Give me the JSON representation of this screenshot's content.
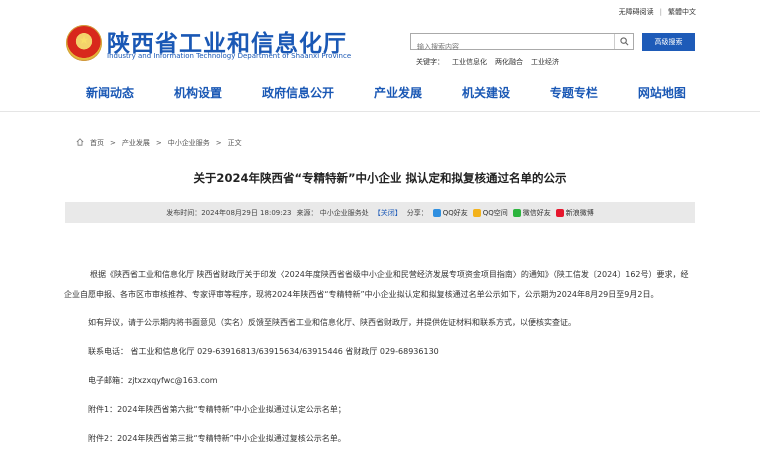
{
  "top_links": {
    "accessibility": "无障碍阅读",
    "language": "繁體中文"
  },
  "header": {
    "title": "陕西省工业和信息化厅",
    "subtitle": "Industry and Information Technology Department of Shaanxi Province"
  },
  "search": {
    "placeholder": "输入搜索内容",
    "advanced_label": "高级搜索"
  },
  "keywords": {
    "label": "关键字：",
    "items": [
      "工业信息化",
      "两化融合",
      "工业经济"
    ]
  },
  "nav": {
    "items": [
      "新闻动态",
      "机构设置",
      "政府信息公开",
      "产业发展",
      "机关建设",
      "专题专栏",
      "网站地图"
    ]
  },
  "breadcrumb": {
    "items": [
      "首页",
      "产业发展",
      "中小企业服务",
      "正文"
    ],
    "separator": ">"
  },
  "article": {
    "title": "关于2024年陕西省“专精特新”中小企业 拟认定和拟复核通过名单的公示",
    "publish_time": "发布时间：2024年08月29日 18:09:23",
    "source": "来源：  中小企业服务处",
    "close_label": "【关闭】",
    "share_label": "分享：",
    "share_items": [
      "QQ好友",
      "QQ空间",
      "微信好友",
      "新浪微博"
    ],
    "paragraph1": "根据《陕西省工业和信息化厅 陕西省财政厅关于印发〈2024年度陕西省省级中小企业和民营经济发展专项资金项目指南〉的通知》（陕工信发〔2024〕162号）要求，经企业自愿申报、各市区市审核推荐、专家评审等程序，现将2024年陕西省“专精特新”中小企业拟认定和拟复核通过名单公示如下，公示期为2024年8月29日至9月2日。",
    "paragraph2": "如有异议，请于公示期内将书面意见（实名）反馈至陕西省工业和信息化厅、陕西省财政厅，并提供佐证材料和联系方式，以便核实查证。",
    "phone_line": "联系电话：  省工业和信息化厅 029-63916813/63915634/63915446        省财政厅 029-68936130",
    "email_line": "电子邮箱：zjtxzxqyfwc@163.com",
    "attachment1": "附件1：2024年陕西省第六批“专精特新”中小企业拟通过认定公示名单；",
    "attachment2": "附件2：2024年陕西省第三批“专精特新”中小企业拟通过复核公示名单。"
  },
  "colors": {
    "brand_blue": "#1a58b5",
    "button_blue": "#1e5bb8",
    "meta_bar": "#e9e9e9"
  }
}
